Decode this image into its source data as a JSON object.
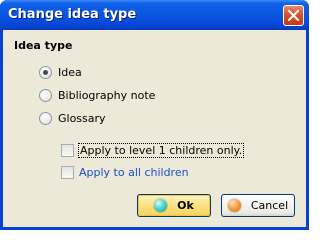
{
  "window": {
    "title": "Change idea type",
    "close_icon": "close-icon"
  },
  "group": {
    "label": "Idea type"
  },
  "options": [
    {
      "label": "Idea",
      "checked": true
    },
    {
      "label": "Bibliography note",
      "checked": false
    },
    {
      "label": "Glossary",
      "checked": false
    }
  ],
  "checks": {
    "level1": {
      "label": "Apply to level 1 children only.",
      "checked": false
    },
    "all": {
      "label": "Apply to all children",
      "checked": false
    }
  },
  "buttons": {
    "ok_label": "Ok",
    "cancel_label": "Cancel"
  },
  "colors": {
    "title_bar": "#0a56e0",
    "dialog_bg": "#ece9d8",
    "ok_bg": "#fbe58a",
    "link_blue": "#1a4fc8"
  }
}
